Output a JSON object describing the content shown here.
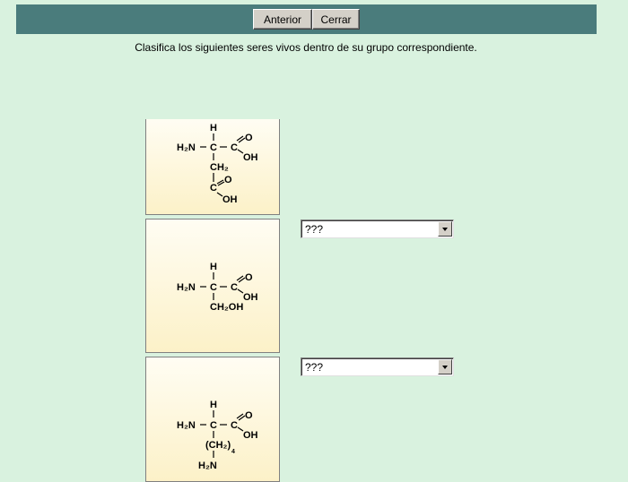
{
  "toolbar": {
    "prev_label": "Anterior",
    "close_label": "Cerrar"
  },
  "instruction": "Clasifica los siguientes seres vivos dentro de su grupo correspondiente.",
  "items": [
    {
      "formula": {
        "h": "H",
        "h2n": "H₂N",
        "c": "C",
        "o": "O",
        "oh": "OH",
        "ch2": "CH₂",
        "c2": "C",
        "oh2": "OH",
        "o2": "O"
      }
    },
    {
      "formula": {
        "h": "H",
        "h2n": "H₂N",
        "c": "C",
        "o": "O",
        "oh": "OH",
        "ch2oh": "CH₂OH"
      },
      "select_value": "???"
    },
    {
      "formula": {
        "h": "H",
        "h2n": "H₂N",
        "c": "C",
        "o": "O",
        "oh": "OH",
        "ch2": "(CH₂)",
        "sub": "4",
        "h2n_bottom": "H₂N"
      },
      "select_value": "???"
    }
  ],
  "icons": {
    "dropdown_arrow": "chevron-down-icon"
  },
  "colors": {
    "background": "#d9f2df",
    "toolbar": "#4a7c7c"
  }
}
